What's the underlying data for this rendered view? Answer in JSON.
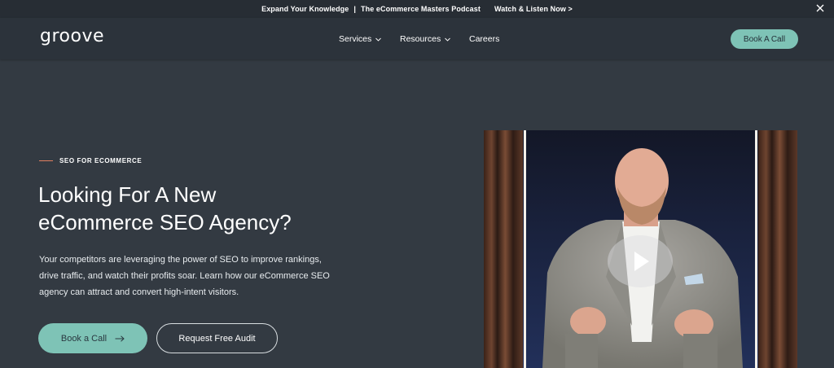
{
  "announcement": {
    "part1": "Expand Your Knowledge",
    "separator": "|",
    "part2": "The eCommerce Masters Podcast",
    "link": "Watch & Listen Now >"
  },
  "nav": {
    "logo": "groove",
    "items": [
      {
        "label": "Services",
        "has_dropdown": true
      },
      {
        "label": "Resources",
        "has_dropdown": true
      },
      {
        "label": "Careers",
        "has_dropdown": false
      }
    ],
    "cta": "Book A Call"
  },
  "hero": {
    "eyebrow": "SEO FOR ECOMMERCE",
    "headline_line1": "Looking For A New",
    "headline_line2": "eCommerce SEO Agency?",
    "description": "Your competitors are leveraging the power of SEO to improve rankings, drive traffic, and watch their profits soar. Learn how our eCommerce SEO agency can attract and convert high-intent visitors.",
    "primary_cta": "Book a Call",
    "secondary_cta": "Request Free Audit"
  },
  "icons": {
    "close": "close-icon",
    "chevron": "chevron-down-icon",
    "arrow": "arrow-right-icon",
    "play": "play-icon"
  },
  "colors": {
    "background": "#333a42",
    "nav_background": "#2c333b",
    "accent": "#7ec3b6",
    "eyebrow_line": "#e08060"
  }
}
